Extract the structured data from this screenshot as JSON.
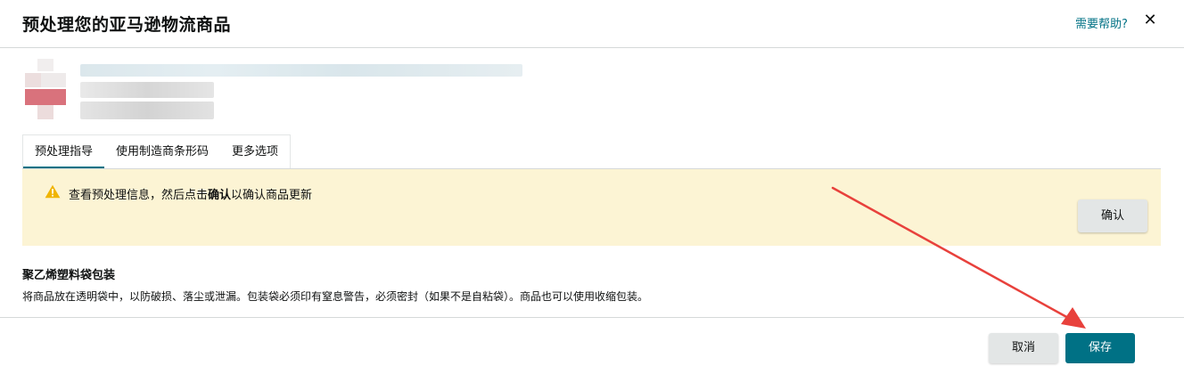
{
  "header": {
    "title": "预处理您的亚马逊物流商品",
    "help_link": "需要帮助?",
    "close_icon": "close-icon"
  },
  "tabs": [
    {
      "label": "预处理指导",
      "active": true
    },
    {
      "label": "使用制造商条形码",
      "active": false
    },
    {
      "label": "更多选项",
      "active": false
    }
  ],
  "alert": {
    "icon": "warning-icon",
    "text_before": "查看预处理信息，然后点击",
    "text_bold": "确认",
    "text_after": "以确认商品更新",
    "confirm_label": "确认",
    "background": "#fcf4d4"
  },
  "packaging": {
    "title": "聚乙烯塑料袋包装",
    "description": "将商品放在透明袋中，以防破损、落尘或泄漏。包装袋必须印有窒息警告，必须密封（如果不是自粘袋）。商品也可以使用收缩包装。"
  },
  "footer": {
    "cancel_label": "取消",
    "save_label": "保存"
  },
  "colors": {
    "accent": "#007185",
    "annotation_arrow": "#e8413c"
  }
}
